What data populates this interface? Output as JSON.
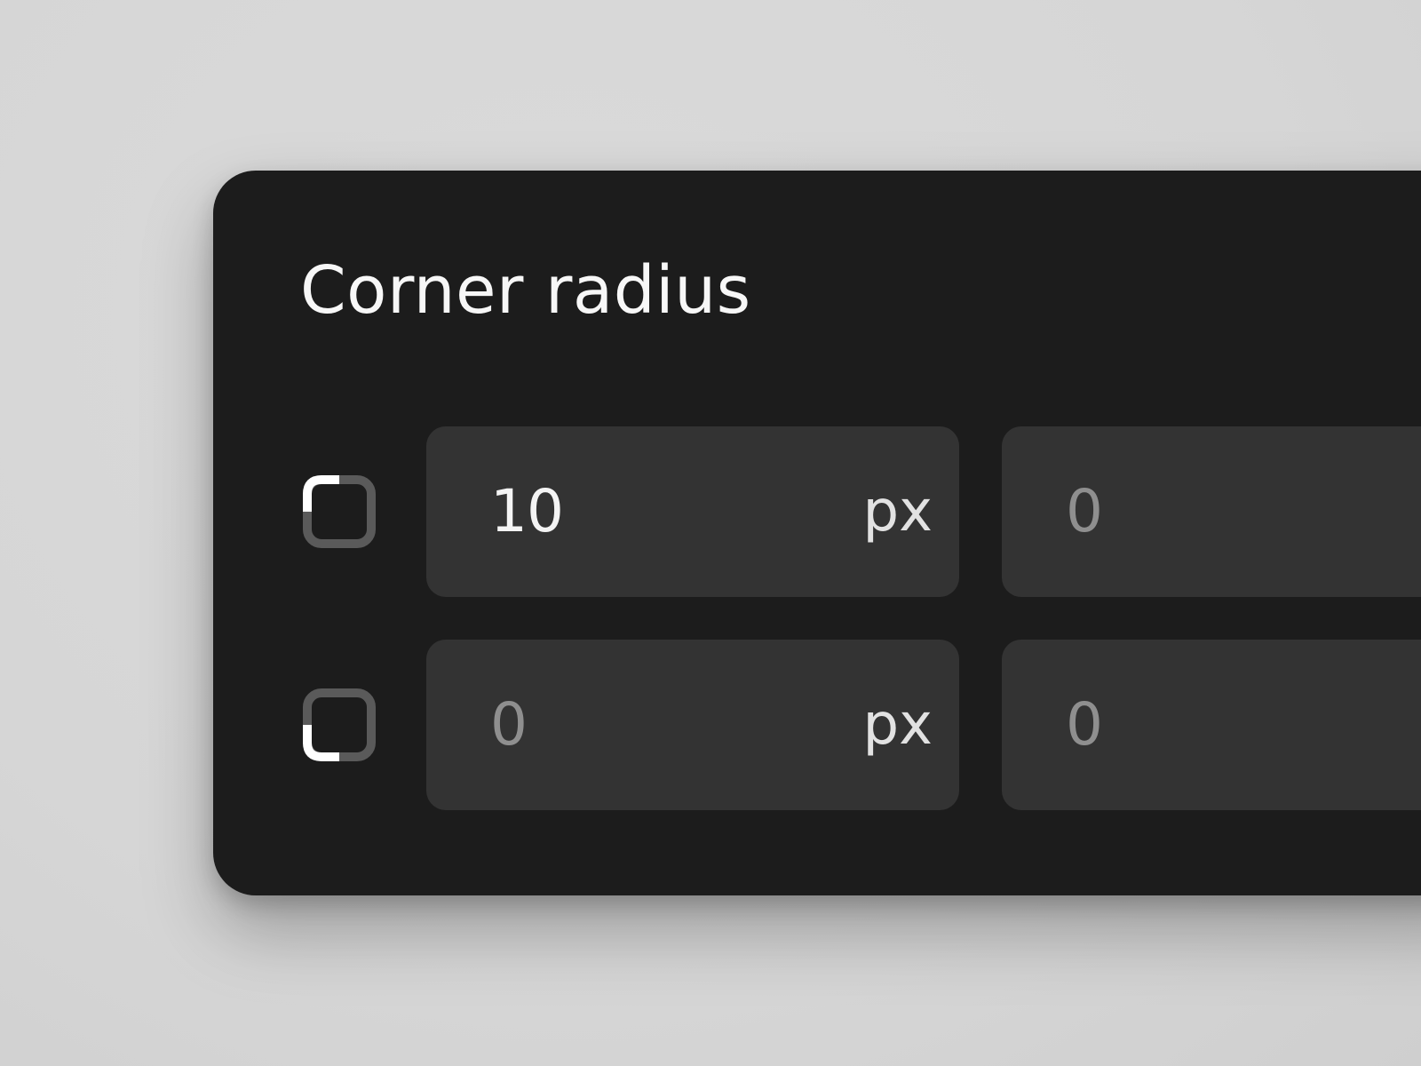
{
  "panel": {
    "title": "Corner radius"
  },
  "icons": {
    "sync": "link-icon",
    "top_left": "corner-top-left-icon",
    "bottom_left": "corner-bottom-left-icon"
  },
  "colors": {
    "panel_bg": "#1c1c1c",
    "field_bg": "#333333",
    "accent": "#3b82f6",
    "text_active": "#f4f4f4",
    "text_placeholder": "#8f8f8f"
  },
  "fields": {
    "top_left": {
      "value": "10",
      "unit": "px"
    },
    "top_right": {
      "value": "0"
    },
    "bottom_left": {
      "value": "0",
      "unit": "px"
    },
    "bottom_right": {
      "value": "0"
    }
  }
}
